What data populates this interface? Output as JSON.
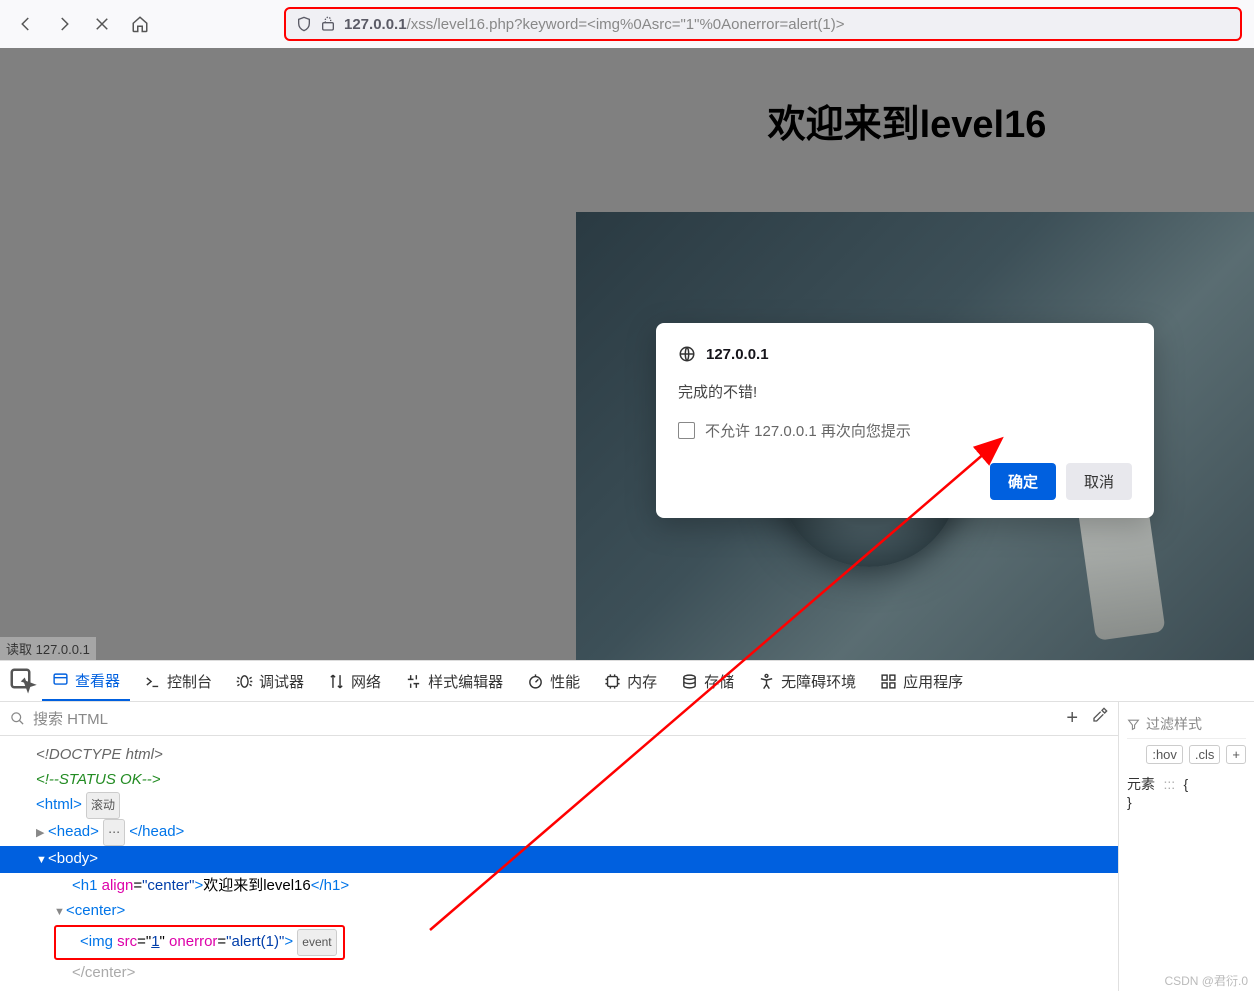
{
  "url": {
    "host": "127.0.0.1",
    "path": "/xss/level16.php?keyword=<img%0Asrc=\"1\"%0Aonerror=alert(1)>"
  },
  "page": {
    "title": "欢迎来到level16",
    "status": "读取 127.0.0.1"
  },
  "alert": {
    "origin": "127.0.0.1",
    "message": "完成的不错!",
    "checkbox": "不允许 127.0.0.1 再次向您提示",
    "ok": "确定",
    "cancel": "取消"
  },
  "devtools": {
    "tabs": {
      "inspector": "查看器",
      "console": "控制台",
      "debugger": "调试器",
      "network": "网络",
      "style": "样式编辑器",
      "performance": "性能",
      "memory": "内存",
      "storage": "存储",
      "a11y": "无障碍环境",
      "apps": "应用程序"
    },
    "search_placeholder": "搜索 HTML",
    "html": {
      "doctype": "<!DOCTYPE html>",
      "comment": "<!--STATUS OK-->",
      "html_open": "<html>",
      "scroll_badge": "滚动",
      "head": "<head>",
      "head_close": "</head>",
      "body": "<body>",
      "h1_open": "<h1 ",
      "h1_attr": "align",
      "h1_val": "\"center\"",
      "h1_text": "欢迎来到level16",
      "h1_close": "</h1>",
      "center_open": "<center>",
      "img_open": "<img ",
      "img_src_attr": "src",
      "img_src_val": "1",
      "img_err_attr": "onerror",
      "img_err_val": "\"alert(1)\"",
      "event_badge": "event",
      "center_close": "</center>",
      "ellipsis": "⋯"
    },
    "styles": {
      "filter": "过滤样式",
      "hov": ":hov",
      "cls": ".cls",
      "plus": "+",
      "rule_sel": "元素",
      "rule_icon": ":::",
      "rule_open": "{",
      "rule_close": "}"
    }
  },
  "watermark": "CSDN @君衍.0"
}
